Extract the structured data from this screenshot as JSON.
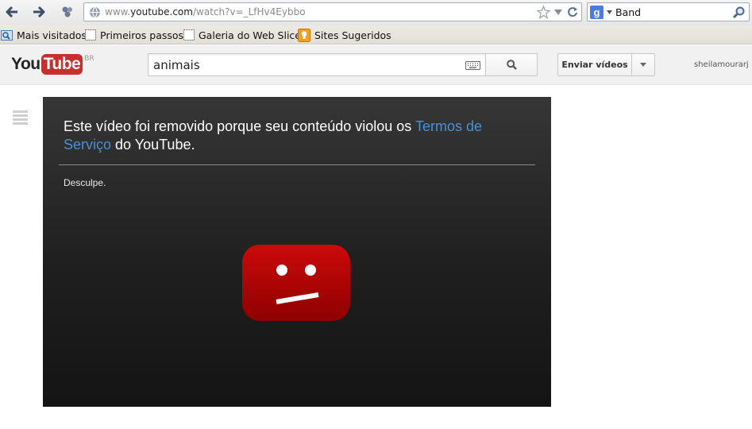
{
  "browser": {
    "url_prefix": "www.",
    "url_host": "youtube.com",
    "url_path": "/watch?v=_LfHv4Eybbo",
    "search_value": "Band"
  },
  "bookmarks": [
    {
      "label": "Mais visitados",
      "icon": "most-visited-icon"
    },
    {
      "label": "Primeiros passos",
      "icon": "page-icon"
    },
    {
      "label": "Galeria do Web Slice",
      "icon": "page-icon"
    },
    {
      "label": "Sites Sugeridos",
      "icon": "suggested-sites-icon"
    }
  ],
  "youtube": {
    "logo_you": "You",
    "logo_tube": "Tube",
    "logo_country": "BR",
    "search_query": "animais",
    "upload_label": "Enviar vídeos",
    "username": "sheilamourarj"
  },
  "player": {
    "message_before": "Este vídeo foi removido porque seu conteúdo violou os ",
    "message_link": "Termos de Serviço",
    "message_after": " do YouTube.",
    "sorry": "Desculpe."
  },
  "colors": {
    "youtube_red": "#c4302b",
    "link_blue": "#4a90d6",
    "sad_face_red": "#b30000"
  }
}
